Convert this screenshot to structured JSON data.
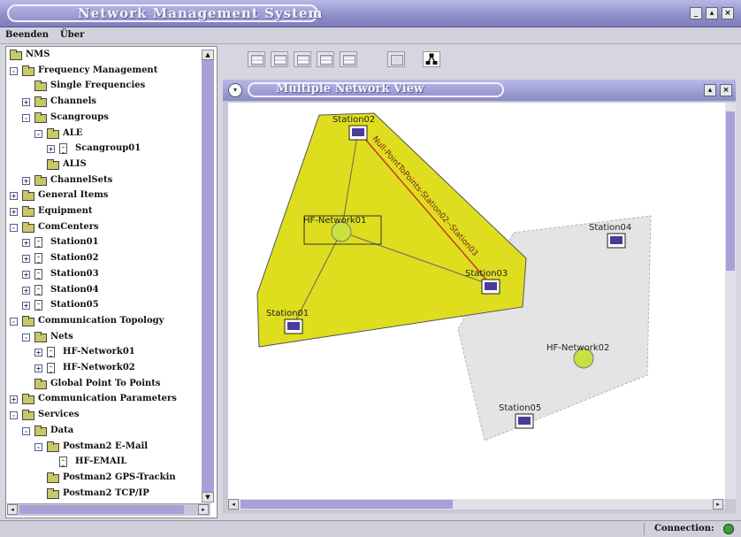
{
  "window": {
    "title": "Network Management System"
  },
  "menu": {
    "items": [
      "Beenden",
      "Über"
    ]
  },
  "tree": {
    "rows": [
      {
        "label": "NMS",
        "indent": 0,
        "icon": "folder",
        "toggle": ""
      },
      {
        "label": "Frequency Management",
        "indent": 1,
        "icon": "folder",
        "toggle": "-"
      },
      {
        "label": "Single Frequencies",
        "indent": 2,
        "icon": "folder",
        "toggle": ""
      },
      {
        "label": "Channels",
        "indent": 2,
        "icon": "folder",
        "toggle": "+"
      },
      {
        "label": "Scangroups",
        "indent": 2,
        "icon": "folder",
        "toggle": "-"
      },
      {
        "label": "ALE",
        "indent": 3,
        "icon": "folder",
        "toggle": "-"
      },
      {
        "label": "Scangroup01",
        "indent": 4,
        "icon": "doc",
        "toggle": "+"
      },
      {
        "label": "ALIS",
        "indent": 3,
        "icon": "folder",
        "toggle": ""
      },
      {
        "label": "ChannelSets",
        "indent": 2,
        "icon": "folder",
        "toggle": "+"
      },
      {
        "label": "General Items",
        "indent": 1,
        "icon": "folder",
        "toggle": "+"
      },
      {
        "label": "Equipment",
        "indent": 1,
        "icon": "folder",
        "toggle": "+"
      },
      {
        "label": "ComCenters",
        "indent": 1,
        "icon": "folder",
        "toggle": "-"
      },
      {
        "label": "Station01",
        "indent": 2,
        "icon": "doc",
        "toggle": "+"
      },
      {
        "label": "Station02",
        "indent": 2,
        "icon": "doc",
        "toggle": "+"
      },
      {
        "label": "Station03",
        "indent": 2,
        "icon": "doc",
        "toggle": "+"
      },
      {
        "label": "Station04",
        "indent": 2,
        "icon": "doc",
        "toggle": "+"
      },
      {
        "label": "Station05",
        "indent": 2,
        "icon": "doc",
        "toggle": "+"
      },
      {
        "label": "Communication Topology",
        "indent": 1,
        "icon": "folder",
        "toggle": "-"
      },
      {
        "label": "Nets",
        "indent": 2,
        "icon": "folder",
        "toggle": "-"
      },
      {
        "label": "HF-Network01",
        "indent": 3,
        "icon": "doc",
        "toggle": "+"
      },
      {
        "label": "HF-Network02",
        "indent": 3,
        "icon": "doc",
        "toggle": "+"
      },
      {
        "label": "Global Point To Points",
        "indent": 2,
        "icon": "folder",
        "toggle": ""
      },
      {
        "label": "Communication Parameters",
        "indent": 1,
        "icon": "folder",
        "toggle": "+"
      },
      {
        "label": "Services",
        "indent": 1,
        "icon": "folder",
        "toggle": "-"
      },
      {
        "label": "Data",
        "indent": 2,
        "icon": "folder",
        "toggle": "-"
      },
      {
        "label": "Postman2 E-Mail",
        "indent": 3,
        "icon": "folder",
        "toggle": "-"
      },
      {
        "label": "HF-EMAIL",
        "indent": 4,
        "icon": "doc",
        "toggle": ""
      },
      {
        "label": "Postman2 GPS-Trackin",
        "indent": 3,
        "icon": "folder",
        "toggle": ""
      },
      {
        "label": "Postman2 TCP/IP",
        "indent": 3,
        "icon": "folder",
        "toggle": ""
      }
    ]
  },
  "inner_window": {
    "title": "Multiple Network View"
  },
  "network": {
    "stations": [
      "Station01",
      "Station02",
      "Station03",
      "Station04",
      "Station05"
    ],
    "networks": [
      "HF-Network01",
      "HF-Network02"
    ],
    "link_label": "Null-PointToPoints-Station02--Station03"
  },
  "status": {
    "connection_label": "Connection:",
    "connection_color": "#2ea82e"
  },
  "colors": {
    "net1_fill": "#dede1e",
    "net2_fill": "#e4e4e4",
    "node_fill": "#c8e040",
    "title_bar": "#9494cc",
    "scroll_thumb": "#a9a0d8"
  }
}
